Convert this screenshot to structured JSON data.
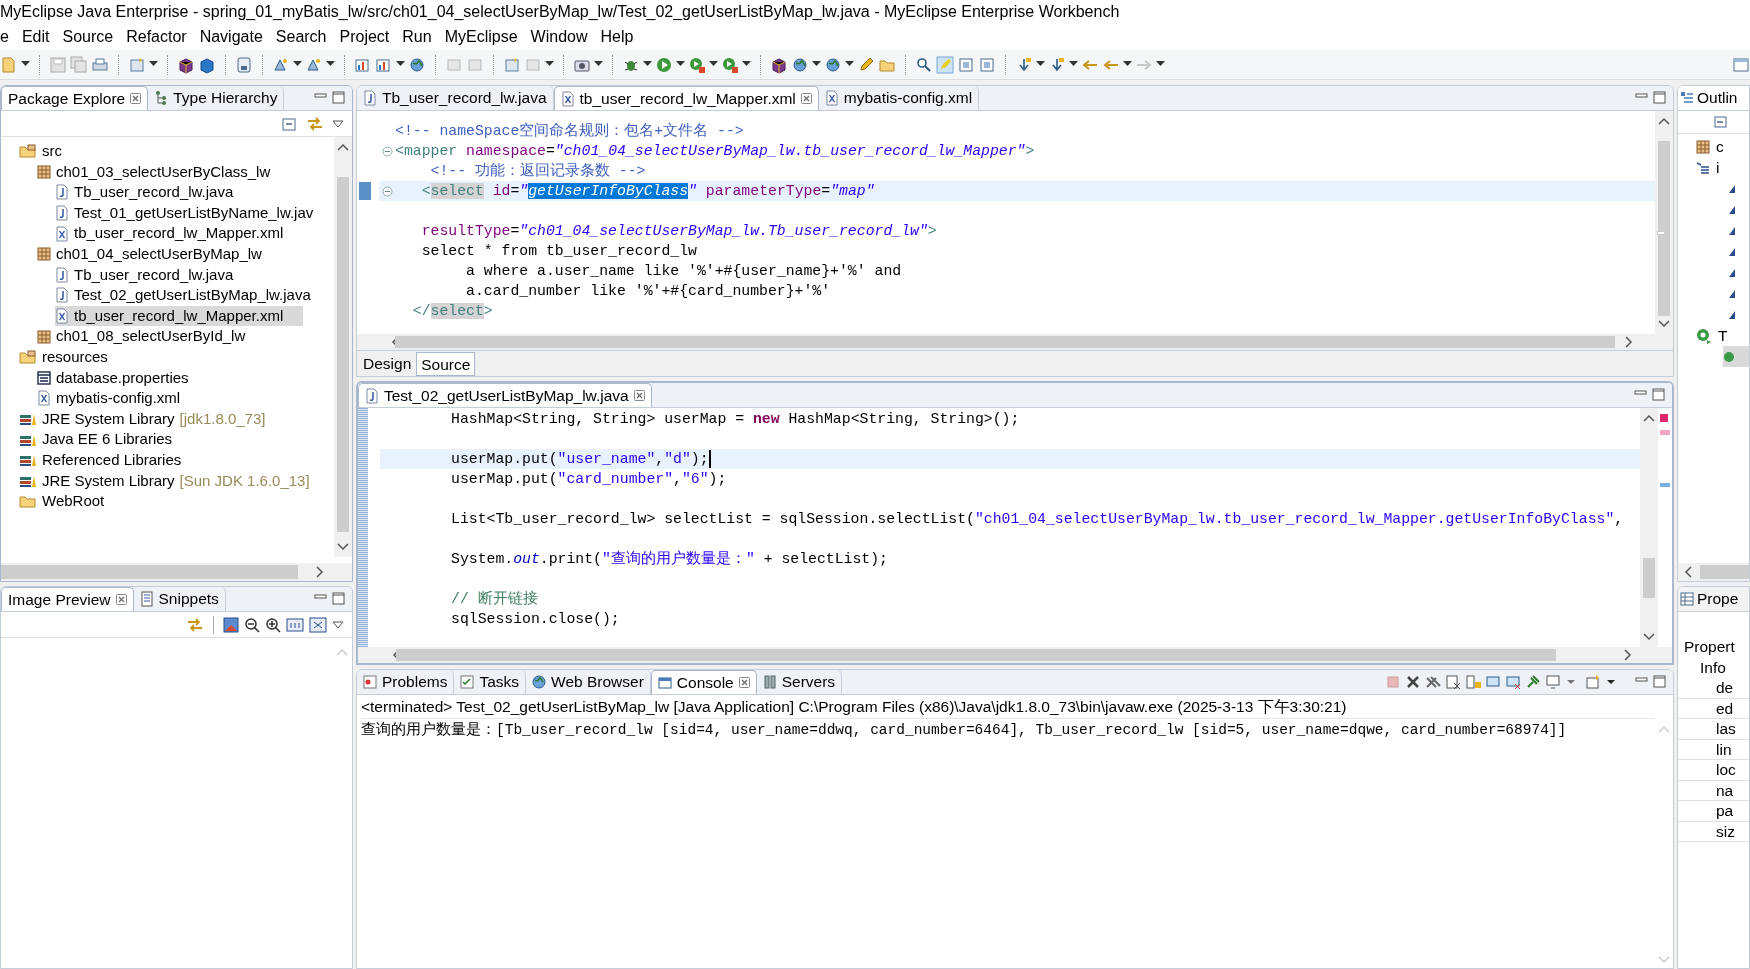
{
  "window": {
    "title": "MyEclipse Java Enterprise - spring_01_myBatis_lw/src/ch01_04_selectUserByMap_lw/Test_02_getUserListByMap_lw.java - MyEclipse Enterprise Workbench"
  },
  "menu": [
    "e",
    "Edit",
    "Source",
    "Refactor",
    "Navigate",
    "Search",
    "Project",
    "Run",
    "MyEclipse",
    "Window",
    "Help"
  ],
  "package_explorer": {
    "tabs": [
      {
        "label": "Package Explore",
        "selected": true
      },
      {
        "label": "Type Hierarchy",
        "selected": false
      }
    ],
    "tree": [
      {
        "label": "src",
        "kind": "srcfolder",
        "selected": false,
        "children": [
          {
            "label": "ch01_03_selectUserByClass_lw",
            "kind": "package",
            "selected": false,
            "children": [
              {
                "label": "Tb_user_record_lw.java",
                "kind": "java",
                "selected": false
              },
              {
                "label": "Test_01_getUserListByName_lw.jav",
                "kind": "java",
                "selected": false
              },
              {
                "label": "tb_user_record_lw_Mapper.xml",
                "kind": "xml",
                "selected": false
              }
            ]
          },
          {
            "label": "ch01_04_selectUserByMap_lw",
            "kind": "package",
            "selected": false,
            "children": [
              {
                "label": "Tb_user_record_lw.java",
                "kind": "java",
                "selected": false
              },
              {
                "label": "Test_02_getUserListByMap_lw.java",
                "kind": "java",
                "selected": false
              },
              {
                "label": "tb_user_record_lw_Mapper.xml",
                "kind": "xml",
                "selected": true
              }
            ]
          },
          {
            "label": "ch01_08_selectUserById_lw",
            "kind": "package",
            "selected": false
          }
        ]
      },
      {
        "label": "resources",
        "kind": "srcfolder",
        "selected": false,
        "children": [
          {
            "label": "database.properties",
            "kind": "properties",
            "selected": false
          },
          {
            "label": "mybatis-config.xml",
            "kind": "xml",
            "selected": false
          }
        ]
      },
      {
        "label": "JRE System Library",
        "decoration": "[jdk1.8.0_73]",
        "kind": "library",
        "selected": false
      },
      {
        "label": "Java EE 6 Libraries",
        "kind": "library",
        "selected": false
      },
      {
        "label": "Referenced Libraries",
        "kind": "library",
        "selected": false
      },
      {
        "label": "JRE System Library",
        "decoration": "[Sun JDK 1.6.0_13]",
        "kind": "library",
        "selected": false
      },
      {
        "label": "WebRoot",
        "kind": "folder",
        "selected": false
      }
    ]
  },
  "image_preview": {
    "tabs": [
      {
        "label": "Image Preview",
        "selected": true
      },
      {
        "label": "Snippets",
        "selected": false
      }
    ]
  },
  "xml_editor": {
    "tabs": [
      {
        "label": "Tb_user_record_lw.java",
        "kind": "java",
        "selected": false
      },
      {
        "label": "tb_user_record_lw_Mapper.xml",
        "kind": "xml",
        "selected": true
      },
      {
        "label": "mybatis-config.xml",
        "kind": "xml",
        "selected": false
      }
    ],
    "lines": [
      {
        "current": false,
        "fold": false,
        "tokens": [
          {
            "kind": "comment",
            "text": "<!-- nameSpace空间命名规则：包名+文件名 -->"
          }
        ]
      },
      {
        "current": false,
        "fold": true,
        "tokens": [
          {
            "kind": "tag",
            "text": "<mapper "
          },
          {
            "kind": "attr",
            "text": "namespace"
          },
          {
            "kind": "plain",
            "text": "="
          },
          {
            "kind": "str",
            "text": "\"ch01_04_selectUserByMap_lw.tb_user_record_lw_Mapper\""
          },
          {
            "kind": "tag",
            "text": ">"
          }
        ]
      },
      {
        "current": false,
        "fold": false,
        "tokens": [
          {
            "kind": "comment",
            "text": "    <!-- 功能：返回记录条数 -->"
          }
        ]
      },
      {
        "current": true,
        "fold": true,
        "tokens": [
          {
            "kind": "tag",
            "text": "   <"
          },
          {
            "kind": "tagmark",
            "text": "select"
          },
          {
            "kind": "attr",
            "text": " id"
          },
          {
            "kind": "plain",
            "text": "="
          },
          {
            "kind": "str",
            "text": "\""
          },
          {
            "kind": "sel",
            "text": "getUserInfoByClass"
          },
          {
            "kind": "str",
            "text": "\""
          },
          {
            "kind": "attr",
            "text": " parameterType"
          },
          {
            "kind": "plain",
            "text": "="
          },
          {
            "kind": "str",
            "text": "\"map\""
          }
        ]
      },
      {
        "current": false,
        "fold": false
      },
      {
        "current": false,
        "fold": false,
        "tokens": [
          {
            "kind": "attr",
            "text": "   resultType"
          },
          {
            "kind": "plain",
            "text": "="
          },
          {
            "kind": "str",
            "text": "\"ch01_04_selectUserByMap_lw.Tb_user_record_lw\""
          },
          {
            "kind": "tag",
            "text": ">"
          }
        ]
      },
      {
        "current": false,
        "fold": false,
        "tokens": [
          {
            "kind": "plain",
            "text": "   select * from tb_user_record_lw"
          }
        ]
      },
      {
        "current": false,
        "fold": false,
        "tokens": [
          {
            "kind": "plain",
            "text": "        a where a.user_name like '%'+#{user_name}+'%' and"
          }
        ]
      },
      {
        "current": false,
        "fold": false,
        "tokens": [
          {
            "kind": "plain",
            "text": "        a.card_number like '%'+#{card_number}+'%'"
          }
        ]
      },
      {
        "current": false,
        "fold": false,
        "tokens": [
          {
            "kind": "tag",
            "text": "  </"
          },
          {
            "kind": "tagmark",
            "text": "select"
          },
          {
            "kind": "tag",
            "text": ">"
          }
        ]
      }
    ],
    "view_tabs": [
      {
        "label": "Design",
        "selected": false
      },
      {
        "label": "Source",
        "selected": true
      }
    ]
  },
  "java_editor": {
    "tabs": [
      {
        "label": "Test_02_getUserListByMap_lw.java",
        "kind": "java",
        "selected": true
      }
    ],
    "caret": true,
    "lines": [
      {
        "current": false,
        "tokens": [
          {
            "kind": "plain",
            "text": "        HashMap<String, String> userMap = "
          },
          {
            "kind": "keyword",
            "text": "new"
          },
          {
            "kind": "plain",
            "text": " HashMap<String, String>();"
          }
        ]
      },
      {
        "current": false
      },
      {
        "current": true,
        "tokens": [
          {
            "kind": "plain",
            "text": "        userMap.put("
          },
          {
            "kind": "jstr",
            "text": "\"user_name\""
          },
          {
            "kind": "plain",
            "text": ","
          },
          {
            "kind": "jstr",
            "text": "\"d\""
          },
          {
            "kind": "plain",
            "text": ");"
          }
        ]
      },
      {
        "current": false,
        "tokens": [
          {
            "kind": "plain",
            "text": "        userMap.put("
          },
          {
            "kind": "jstr",
            "text": "\"card_number\""
          },
          {
            "kind": "plain",
            "text": ","
          },
          {
            "kind": "jstr",
            "text": "\"6\""
          },
          {
            "kind": "plain",
            "text": ");"
          }
        ]
      },
      {
        "current": false
      },
      {
        "current": false,
        "tokens": [
          {
            "kind": "plain",
            "text": "        List<Tb_user_record_lw> selectList = sqlSession.selectList("
          },
          {
            "kind": "jstr",
            "text": "\"ch01_04_selectUserByMap_lw.tb_user_record_lw_Mapper.getUserInfoByClass\""
          },
          {
            "kind": "plain",
            "text": ","
          }
        ]
      },
      {
        "current": false
      },
      {
        "current": false,
        "tokens": [
          {
            "kind": "plain",
            "text": "        System."
          },
          {
            "kind": "field",
            "text": "out"
          },
          {
            "kind": "plain",
            "text": ".print("
          },
          {
            "kind": "jstr",
            "text": "\"查询的用户数量是：\""
          },
          {
            "kind": "plain",
            "text": " + selectList);"
          }
        ]
      },
      {
        "current": false
      },
      {
        "current": false,
        "tokens": [
          {
            "kind": "jcomment",
            "text": "        // 断开链接"
          }
        ]
      },
      {
        "current": false,
        "tokens": [
          {
            "kind": "plain",
            "text": "        sqlSession.close();"
          }
        ]
      }
    ]
  },
  "console": {
    "tabs": [
      {
        "label": "Problems",
        "kind": "problems",
        "selected": false
      },
      {
        "label": "Tasks",
        "kind": "tasks",
        "selected": false
      },
      {
        "label": "Web Browser",
        "kind": "browser",
        "selected": false
      },
      {
        "label": "Console",
        "kind": "console",
        "selected": true
      },
      {
        "label": "Servers",
        "kind": "servers",
        "selected": false
      }
    ],
    "header": "<terminated> Test_02_getUserListByMap_lw [Java Application] C:\\Program Files (x86)\\Java\\jdk1.8.0_73\\bin\\javaw.exe (2025-3-13 下午3:30:21)",
    "output": [
      "查询的用户数量是：[Tb_user_record_lw [sid=4, user_name=ddwq, card_number=6464], Tb_user_record_lw [sid=5, user_name=dqwe, card_number=68974]]"
    ]
  },
  "outline": {
    "tab": "Outlin",
    "rows": [
      {
        "kind": "package",
        "label": "c",
        "selected": false
      },
      {
        "kind": "imports",
        "label": "i",
        "selected": false
      },
      {
        "kind": "import",
        "selected": false
      },
      {
        "kind": "import",
        "selected": false
      },
      {
        "kind": "import",
        "selected": false
      },
      {
        "kind": "import",
        "selected": false
      },
      {
        "kind": "import",
        "selected": false
      },
      {
        "kind": "import",
        "selected": false
      },
      {
        "kind": "import",
        "selected": false
      },
      {
        "kind": "class",
        "label": "T",
        "selected": false
      },
      {
        "kind": "method",
        "selected": true
      }
    ]
  },
  "properties": {
    "tab": "Prope",
    "header": "Propert",
    "group": "Info",
    "rows": [
      "de",
      "ed",
      "las",
      "lin",
      "loc",
      "na",
      "pa",
      "siz"
    ]
  }
}
